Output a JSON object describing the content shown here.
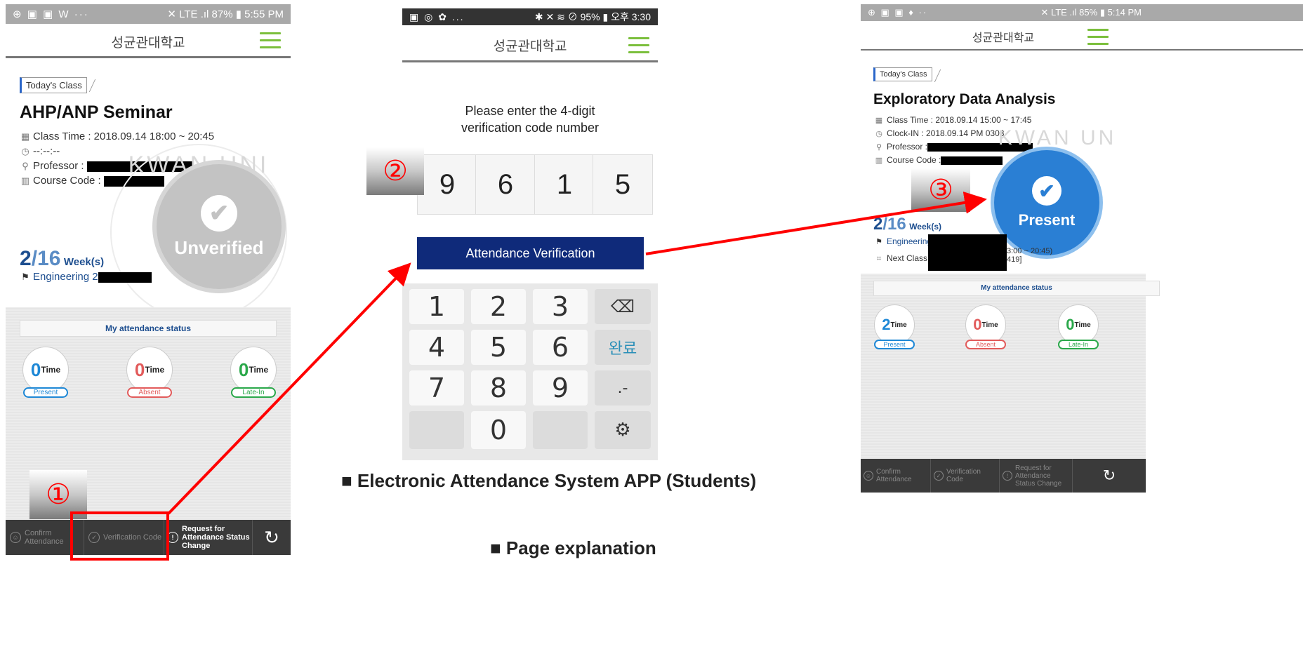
{
  "phone1": {
    "status_left": "⊕ ▣ ▣ W ···",
    "status_right": "✕ LTE .ıl 87% ▮ 5:55 PM",
    "app_title": "성균관대학교",
    "tag": "Today's Class",
    "course_name": "AHP/ANP Seminar",
    "class_time": "Class Time : 2018.09.14 18:00 ~ 20:45",
    "clock_in": "--:--:--",
    "professor_label": "Professor :",
    "course_code_label": "Course Code :",
    "week_current": "2",
    "week_total": "/16",
    "week_unit": "Week(s)",
    "location": "Engineering 2",
    "status_circle": "Unverified",
    "watermark": "KWAN UNI",
    "attendance_title": "My attendance status",
    "stats": [
      {
        "num": "0",
        "unit": "Time",
        "label": "Present",
        "color": "#1e88d6"
      },
      {
        "num": "0",
        "unit": "Time",
        "label": "Absent",
        "color": "#e25b5b"
      },
      {
        "num": "0",
        "unit": "Time",
        "label": "Late-In",
        "color": "#2aa84a"
      }
    ],
    "step": "①",
    "nav": [
      {
        "label": "Confirm Attendance",
        "icon": "person"
      },
      {
        "label": "Verification Code",
        "icon": "check"
      },
      {
        "label": "Request for Attendance Status Change",
        "icon": "!"
      }
    ],
    "refresh_icon": "↻"
  },
  "phone2": {
    "status_left": "▣ ◎ ✿ ...",
    "status_right": "✱ ✕ ≋ ⊘ 95% ▮ 오후 3:30",
    "app_title": "성균관대학교",
    "prompt_line1": "Please enter the 4-digit",
    "prompt_line2": "verification code number",
    "digits": [
      "9",
      "6",
      "1",
      "5"
    ],
    "step": "②",
    "verify_button": "Attendance Verification",
    "keys": [
      "1",
      "2",
      "3",
      "⌫",
      "4",
      "5",
      "6",
      "완료",
      "7",
      "8",
      "9",
      ".-",
      "",
      "0",
      "",
      "⚙"
    ]
  },
  "phone3": {
    "status_left": "⊕ ▣ ▣ ♦ ··",
    "status_right": "✕ LTE .ıl 85% ▮ 5:14 PM",
    "app_title": "성균관대학교",
    "tag": "Today's Class",
    "course_name": "Exploratory Data Analysis",
    "class_time": "Class Time : 2018.09.14 15:00 ~ 17:45",
    "clock_in": "Clock-IN : 2018.09.14 PM 0303",
    "professor_label": "Professor :",
    "course_code_label": "Course Code :",
    "week_current": "2",
    "week_total": "/16",
    "week_unit": "Week(s)",
    "location": "Engineering",
    "next_class": "Next Class :",
    "next_fragment1": "3:00 ~ 20:45)",
    "next_fragment2": "419]",
    "status_circle": "Present",
    "watermark": "KWAN UN",
    "step": "③",
    "attendance_title": "My attendance status",
    "stats": [
      {
        "num": "2",
        "unit": "Time",
        "label": "Present",
        "color": "#1e88d6"
      },
      {
        "num": "0",
        "unit": "Time",
        "label": "Absent",
        "color": "#e25b5b"
      },
      {
        "num": "0",
        "unit": "Time",
        "label": "Late-In",
        "color": "#2aa84a"
      }
    ],
    "nav": [
      {
        "label": "Confirm Attendance",
        "icon": "person"
      },
      {
        "label": "Verification Code",
        "icon": "check"
      },
      {
        "label": "Request for Attendance Status Change",
        "icon": "!"
      }
    ],
    "refresh_icon": "↻"
  },
  "captions": {
    "app_caption": "■ Electronic Attendance System APP (Students)",
    "page_caption": "■ Page explanation"
  },
  "colors": {
    "accent_red": "#ff0000",
    "brand_navy": "#0f2a7a",
    "present_blue": "#2a7fd4",
    "menu_green": "#7bbf3c"
  }
}
